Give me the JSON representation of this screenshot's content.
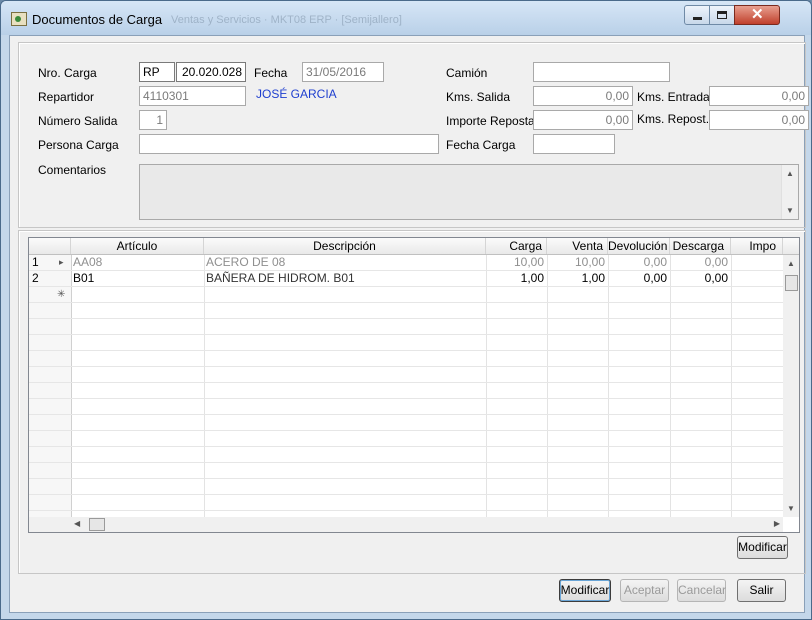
{
  "window": {
    "title": "Documentos de Carga",
    "ghost_title": "Ventas y Servicios · MKT08 ERP · [Semijallero]"
  },
  "form": {
    "nro_carga": {
      "label": "Nro. Carga",
      "serie": "RP",
      "numero": "20.020.028"
    },
    "fecha": {
      "label": "Fecha",
      "value": "31/05/2016"
    },
    "camion": {
      "label": "Camión",
      "value": ""
    },
    "repartidor": {
      "label": "Repartidor",
      "code": "4110301",
      "name": "JOSÉ GARCIA"
    },
    "kms_salida": {
      "label": "Kms. Salida",
      "value": "0,00"
    },
    "kms_entrada": {
      "label": "Kms. Entrada",
      "value": "0,00"
    },
    "numero_salida": {
      "label": "Número Salida",
      "value": "1"
    },
    "importe_repostaje": {
      "label": "Importe Repostaje",
      "value": "0,00"
    },
    "kms_repost": {
      "label": "Kms. Repost.",
      "value": "0,00"
    },
    "persona_carga": {
      "label": "Persona Carga",
      "value": ""
    },
    "fecha_carga": {
      "label": "Fecha Carga",
      "value": ""
    },
    "comentarios": {
      "label": "Comentarios",
      "value": ""
    }
  },
  "grid": {
    "columns": [
      "Artículo",
      "Descripción",
      "Carga",
      "Venta",
      "Devolución",
      "Descarga",
      "Impo"
    ],
    "rows": [
      {
        "num": "1",
        "marker": "▸",
        "articulo": "AA08",
        "descripcion": "ACERO DE 08",
        "carga": "10,00",
        "venta": "10,00",
        "devolucion": "0,00",
        "descarga": "0,00",
        "disabled": true
      },
      {
        "num": "2",
        "marker": "",
        "articulo": "B01",
        "descripcion": "BAÑERA DE HIDROM. B01",
        "carga": "1,00",
        "venta": "1,00",
        "devolucion": "0,00",
        "descarga": "0,00",
        "disabled": false
      }
    ],
    "new_row_marker": "✳",
    "modificar_label": "Modificar"
  },
  "footer": {
    "modificar": "Modificar",
    "aceptar": "Aceptar",
    "cancelar": "Cancelar",
    "salir": "Salir"
  }
}
